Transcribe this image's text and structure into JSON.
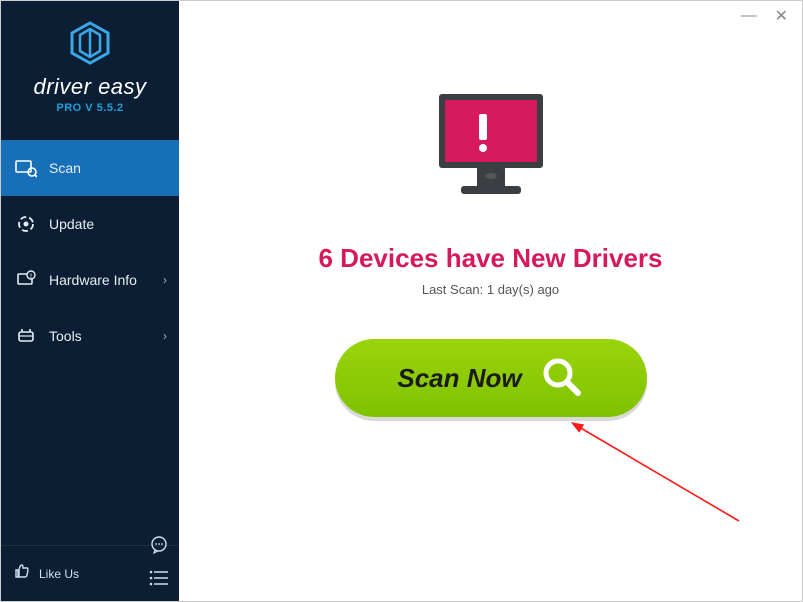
{
  "app": {
    "brand": "driver easy",
    "version": "PRO V 5.5.2"
  },
  "sidebar": {
    "items": [
      {
        "label": "Scan"
      },
      {
        "label": "Update"
      },
      {
        "label": "Hardware Info"
      },
      {
        "label": "Tools"
      }
    ],
    "like_label": "Like Us"
  },
  "main": {
    "status_title": "6 Devices have New Drivers",
    "last_scan": "Last Scan: 1 day(s) ago",
    "scan_button": "Scan Now"
  },
  "colors": {
    "accent_blue": "#176fb8",
    "alert_pink": "#d6195c",
    "scan_green": "#8fcf06"
  }
}
